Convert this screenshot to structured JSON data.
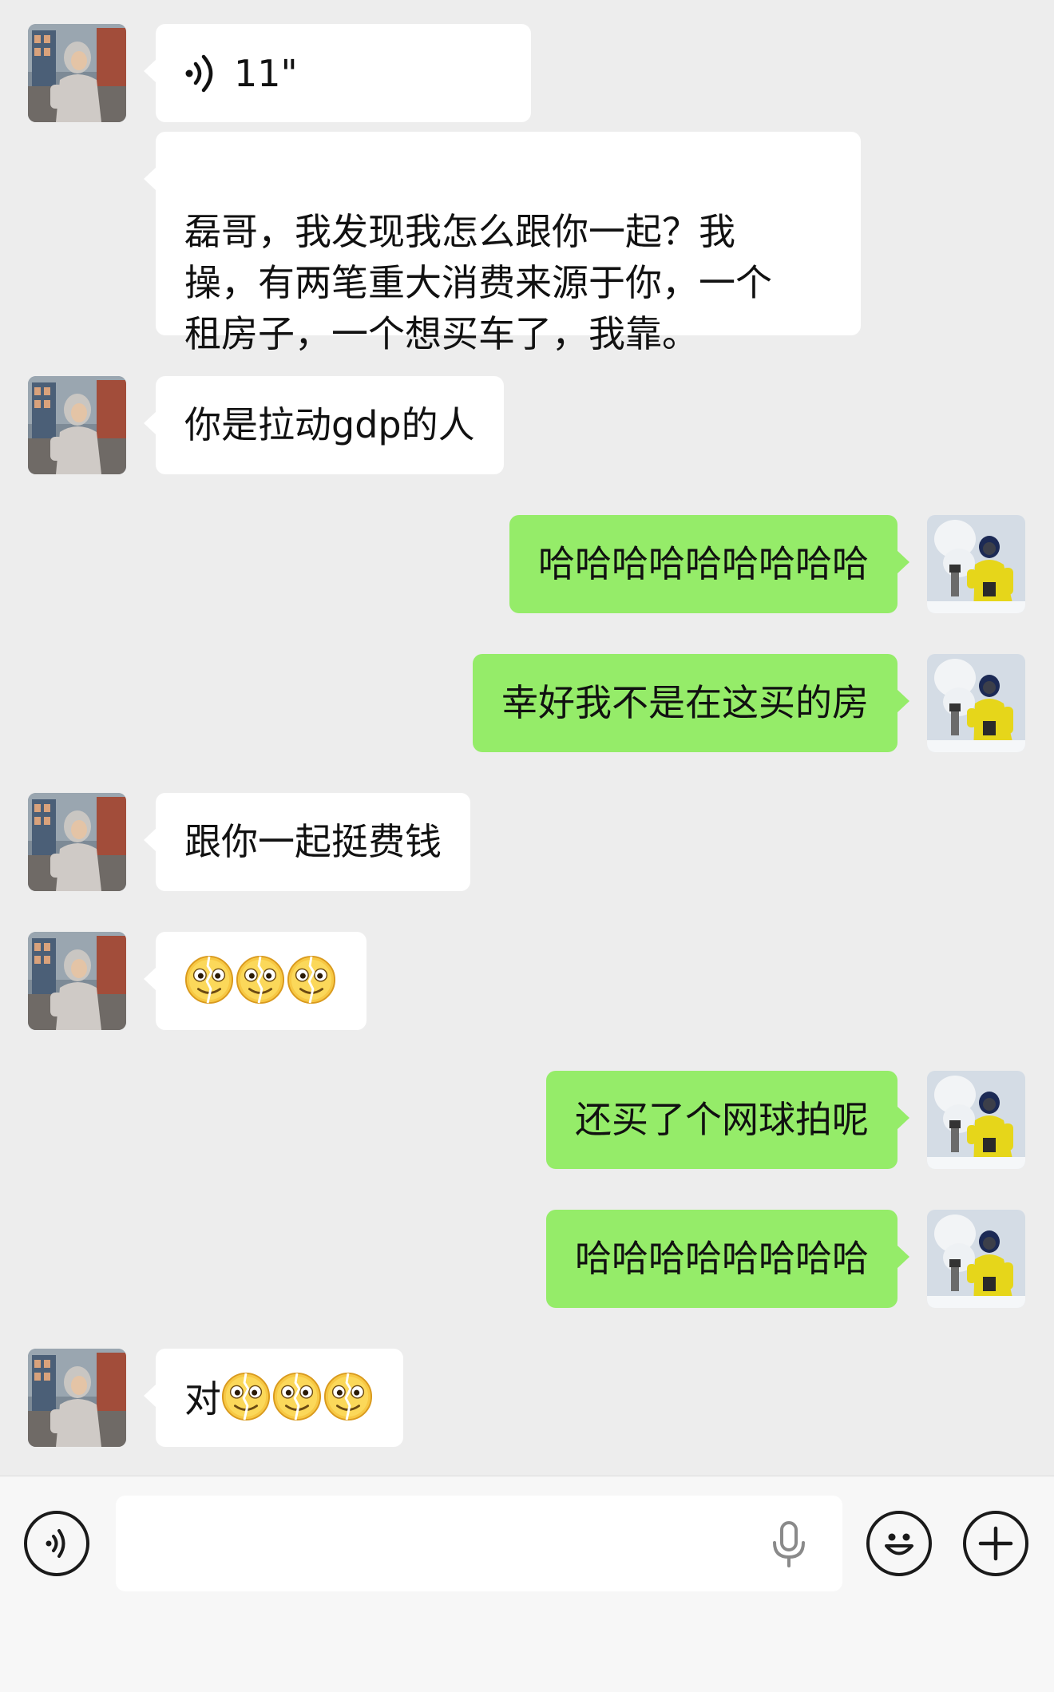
{
  "messages": [
    {
      "side": "in",
      "kind": "voice",
      "duration": "11\""
    },
    {
      "side": "in",
      "kind": "text",
      "text": "磊哥，我发现我怎么跟你一起？我\n操，有两笔重大消费来源于你，一个\n租房子，一个想买车了，我靠。"
    },
    {
      "side": "in",
      "kind": "text",
      "text": "你是拉动gdp的人"
    },
    {
      "side": "out",
      "kind": "text",
      "text": "哈哈哈哈哈哈哈哈哈"
    },
    {
      "side": "out",
      "kind": "text",
      "text": "幸好我不是在这买的房"
    },
    {
      "side": "in",
      "kind": "text",
      "text": "跟你一起挺费钱"
    },
    {
      "side": "in",
      "kind": "emoji",
      "text": "",
      "emojis": [
        "cracked-smile-emoji",
        "cracked-smile-emoji",
        "cracked-smile-emoji"
      ]
    },
    {
      "side": "out",
      "kind": "text",
      "text": "还买了个网球拍呢"
    },
    {
      "side": "out",
      "kind": "text",
      "text": "哈哈哈哈哈哈哈哈"
    },
    {
      "side": "in",
      "kind": "emoji",
      "text": "对",
      "emojis": [
        "cracked-smile-emoji",
        "cracked-smile-emoji",
        "cracked-smile-emoji"
      ]
    }
  ],
  "input_bar": {
    "voice_toggle_icon": "voice-icon",
    "text_value": "",
    "mic_icon": "microphone-icon",
    "emoji_icon": "smiley-icon",
    "more_icon": "plus-icon"
  },
  "colors": {
    "chat_background": "#ededed",
    "incoming_bubble": "#ffffff",
    "outgoing_bubble": "#95ec69",
    "input_bar_background": "#f7f7f7"
  }
}
